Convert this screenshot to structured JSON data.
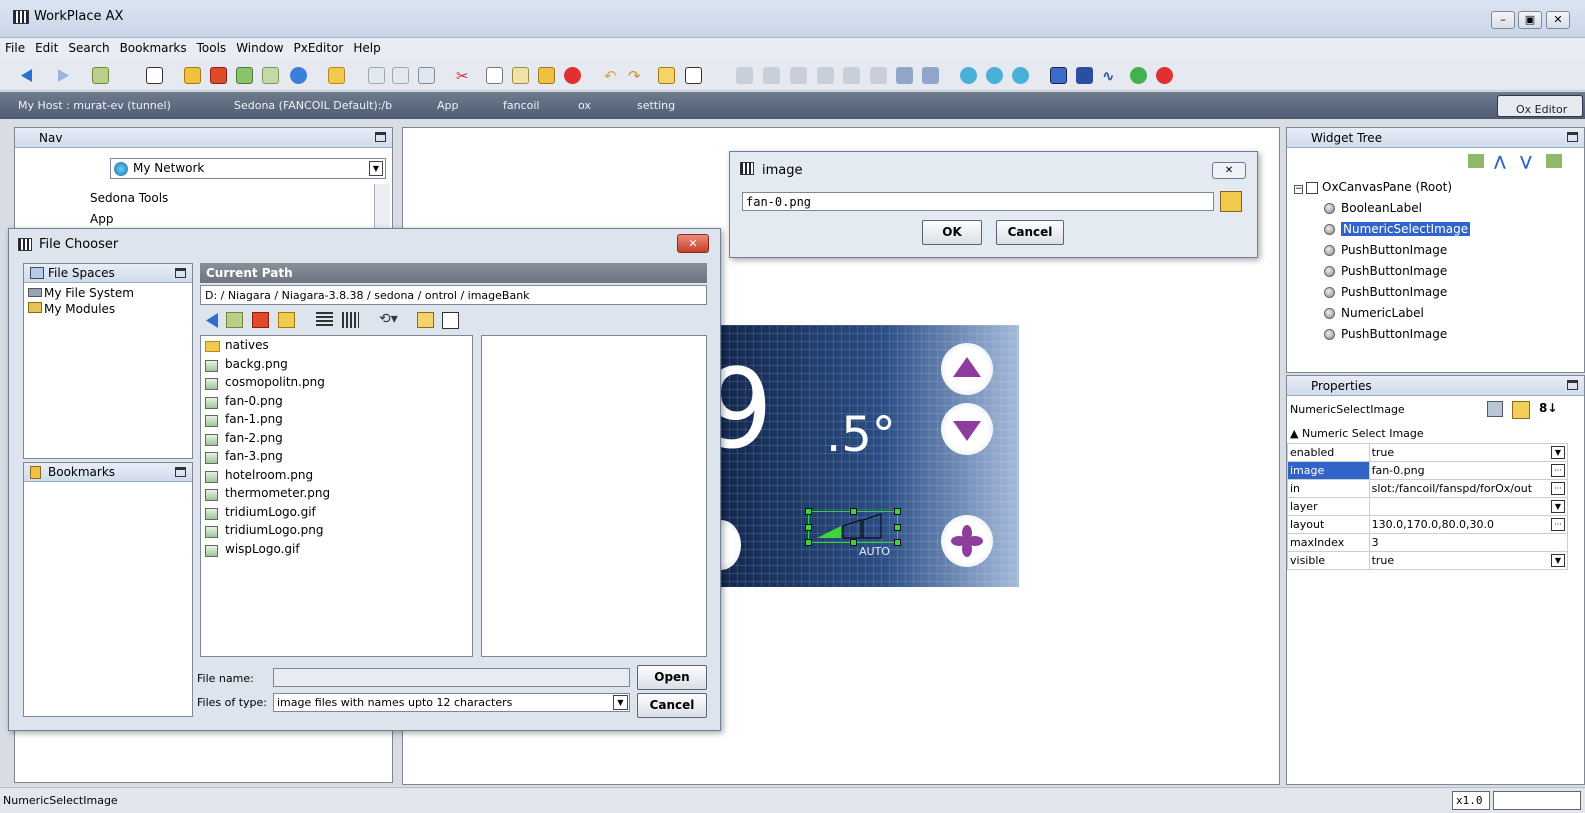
{
  "window": {
    "title": "WorkPlace AX"
  },
  "menu": [
    "File",
    "Edit",
    "Search",
    "Bookmarks",
    "Tools",
    "Window",
    "PxEditor",
    "Help"
  ],
  "address": {
    "host": "My Host : murat-ev (tunnel)",
    "station": "Sedona (FANCOIL Default):/b",
    "app": "App",
    "fancoil": "fancoil",
    "ox": "ox",
    "setting": "setting",
    "ox_editor": "Ox Editor"
  },
  "nav": {
    "title": "Nav",
    "network_select": "My Network",
    "items": [
      "Sedona Tools",
      "App"
    ]
  },
  "image_dialog": {
    "title": "image",
    "value": "fan-0.png",
    "ok": "OK",
    "cancel": "Cancel"
  },
  "canvas": {
    "temp_main": "9",
    "temp_dec": ".5°",
    "fan_mode": "AUTO"
  },
  "file_chooser": {
    "title": "File Chooser",
    "file_spaces_title": "File Spaces",
    "spaces": [
      "My File System",
      "My Modules"
    ],
    "bookmarks_title": "Bookmarks",
    "current_path_label": "Current Path",
    "current_path": "D: / Niagara / Niagara-3.8.38 / sedona / ontrol / imageBank",
    "folders": [
      "natives"
    ],
    "files": [
      "backg.png",
      "cosmopolitn.png",
      "fan-0.png",
      "fan-1.png",
      "fan-2.png",
      "fan-3.png",
      "hotelroom.png",
      "thermometer.png",
      "tridiumLogo.gif",
      "tridiumLogo.png",
      "wispLogo.gif"
    ],
    "file_name_label": "File name:",
    "file_name_value": "",
    "files_of_type_label": "Files of type:",
    "files_of_type_value": "image files with names upto 12 characters",
    "open": "Open",
    "cancel": "Cancel"
  },
  "widget_tree": {
    "title": "Widget Tree",
    "root": "OxCanvasPane (Root)",
    "children": [
      "BooleanLabel",
      "NumericSelectImage",
      "PushButtonImage",
      "PushButtonImage",
      "PushButtonImage",
      "NumericLabel",
      "PushButtonImage"
    ],
    "selected_index": 1
  },
  "properties": {
    "title": "Properties",
    "component": "NumericSelectImage",
    "group": "Numeric Select Image",
    "rows": [
      {
        "name": "enabled",
        "value": "true",
        "ctl": "dd"
      },
      {
        "name": "image",
        "value": "fan-0.png",
        "ctl": "more"
      },
      {
        "name": "in",
        "value": "slot:/fancoil/fanspd/forOx/out",
        "ctl": "more"
      },
      {
        "name": "layer",
        "value": "",
        "ctl": "dd"
      },
      {
        "name": "layout",
        "value": "130.0,170.0,80.0,30.0",
        "ctl": "more"
      },
      {
        "name": "maxIndex",
        "value": "3",
        "ctl": ""
      },
      {
        "name": "visible",
        "value": "true",
        "ctl": "dd"
      }
    ]
  },
  "status": {
    "text": "NumericSelectImage",
    "zoom": "x1.0"
  },
  "colors": {
    "selection": "#3164c6",
    "thermostat_bg": "#1e3a6e",
    "arrow": "#8e3d9e"
  }
}
